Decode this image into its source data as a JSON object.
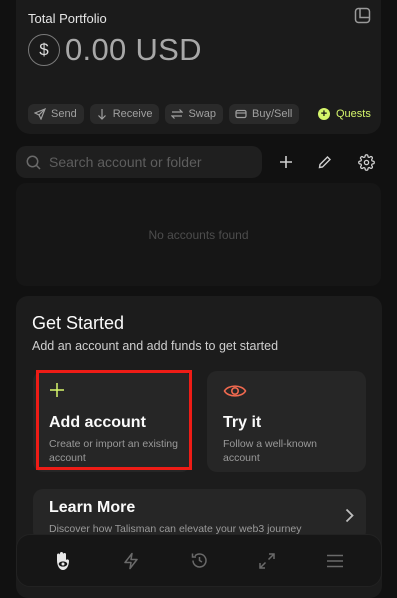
{
  "portfolio": {
    "title": "Total Portfolio",
    "currency_symbol": "$",
    "balance": "0.00 USD",
    "actions": [
      {
        "label": "Send",
        "icon": "send-icon"
      },
      {
        "label": "Receive",
        "icon": "receive-icon"
      },
      {
        "label": "Swap",
        "icon": "swap-icon"
      },
      {
        "label": "Buy/Sell",
        "icon": "card-icon"
      }
    ],
    "quests_label": "Quests",
    "accent_color": "#d5f56b"
  },
  "search": {
    "placeholder": "Search account or folder"
  },
  "accounts": {
    "empty_text": "No accounts found"
  },
  "get_started": {
    "title": "Get Started",
    "subtitle": "Add an account and add funds to get started",
    "cards": [
      {
        "title": "Add account",
        "description": "Create or import an existing account",
        "icon": "plus-icon"
      },
      {
        "title": "Try it",
        "description": "Follow a well-known account",
        "icon": "eye-icon"
      }
    ],
    "learn_more": {
      "title": "Learn More",
      "description": "Discover how Talisman can elevate your web3 journey"
    }
  },
  "bottom_nav": [
    "talisman-logo-icon",
    "lightning-icon",
    "history-icon",
    "expand-icon",
    "menu-icon"
  ]
}
